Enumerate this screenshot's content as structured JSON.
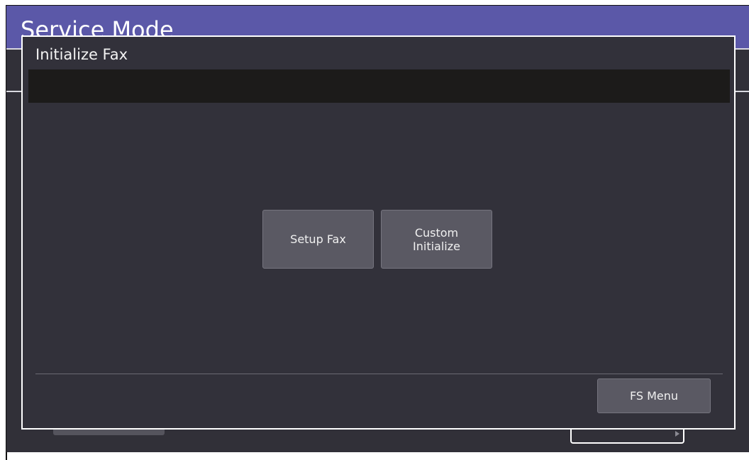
{
  "app": {
    "title": "Service Mode"
  },
  "dialog": {
    "title": "Initialize Fax",
    "message": ""
  },
  "buttons": {
    "setup_fax": "Setup Fax",
    "custom_initialize": "Custom\nInitialize",
    "fs_menu": "FS Menu"
  },
  "colors": {
    "title_bar": "#5b58a8",
    "background": "#313038",
    "button": "#5a5963",
    "message_bar": "#1c1b1a"
  }
}
